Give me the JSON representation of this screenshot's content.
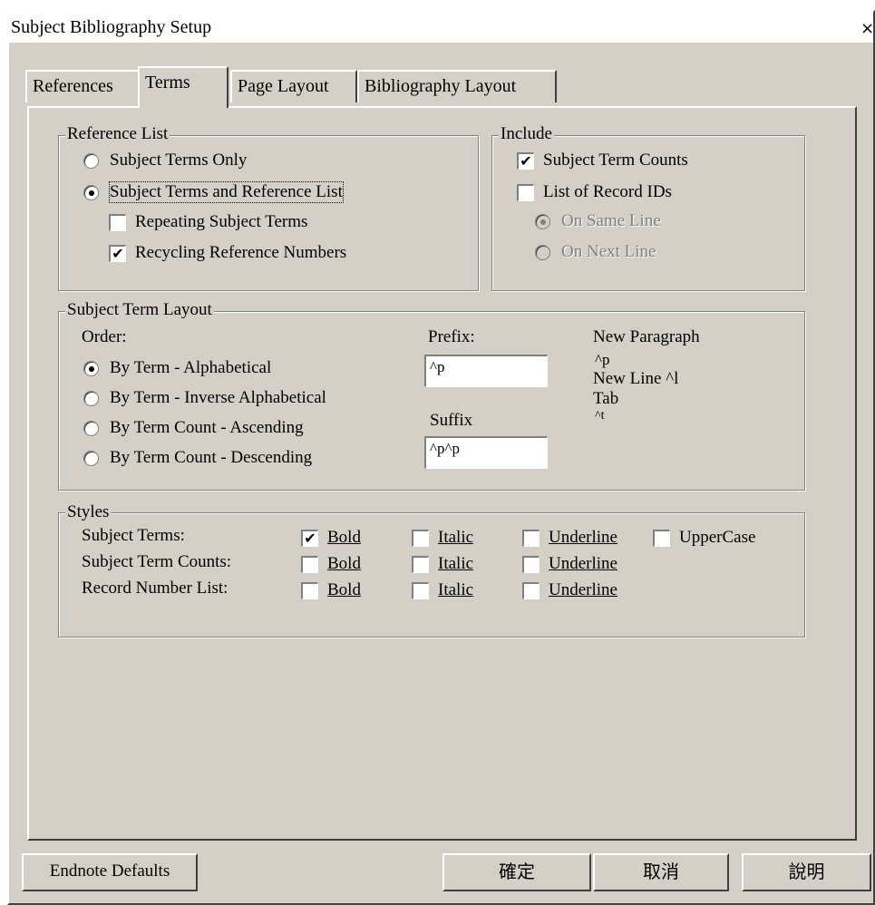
{
  "window": {
    "title": "Subject Bibliography Setup",
    "close_label": "×"
  },
  "tabs": [
    {
      "label": "References",
      "active": false
    },
    {
      "label": "Terms",
      "active": true
    },
    {
      "label": "Page Layout",
      "active": false
    },
    {
      "label": "Bibliography Layout",
      "active": false
    }
  ],
  "reference_list": {
    "legend": "Reference List",
    "subject_terms_only": "Subject Terms Only",
    "terms_and_list": "Subject Terms and Reference List",
    "repeating": "Repeating Subject Terms",
    "recycling": "Recycling Reference Numbers",
    "selected": "terms_and_list",
    "repeating_checked": false,
    "recycling_checked": true
  },
  "include": {
    "legend": "Include",
    "term_counts": "Subject Term Counts",
    "record_ids": "List of Record IDs",
    "same_line": "On Same Line",
    "next_line": "On Next Line",
    "term_counts_checked": true,
    "record_ids_checked": false,
    "selected": "same_line"
  },
  "layout": {
    "legend": "Subject Term Layout",
    "order_label": "Order:",
    "by_term_alpha": "By Term - Alphabetical",
    "by_term_inverse": "By Term - Inverse Alphabetical",
    "by_count_asc": "By Term Count - Ascending",
    "by_count_desc": "By Term Count - Descending",
    "selected": "by_term_alpha",
    "prefix_label": "Prefix:",
    "prefix_value": "^p",
    "suffix_label": "Suffix",
    "suffix_value": "^p^p",
    "hints": {
      "new_paragraph": "New Paragraph",
      "new_paragraph_code": "^p",
      "new_line": "New Line ^l",
      "tab": "Tab",
      "tab_code": "^t"
    }
  },
  "styles": {
    "legend": "Styles",
    "bold": "Bold",
    "italic": "Italic",
    "underline": "Underline",
    "uppercase": "UpperCase",
    "rows": [
      {
        "label": "Subject Terms:",
        "bold": true,
        "italic": false,
        "underline": false,
        "uppercase": false
      },
      {
        "label": "Subject Term Counts:",
        "bold": false,
        "italic": false,
        "underline": false
      },
      {
        "label": "Record Number List:",
        "bold": false,
        "italic": false,
        "underline": false
      }
    ]
  },
  "footer": {
    "defaults": "Endnote Defaults",
    "ok": "確定",
    "cancel": "取消",
    "help": "說明"
  },
  "colors": {
    "dialog_bg": "#d4d0c8",
    "disabled_text": "#808080"
  }
}
